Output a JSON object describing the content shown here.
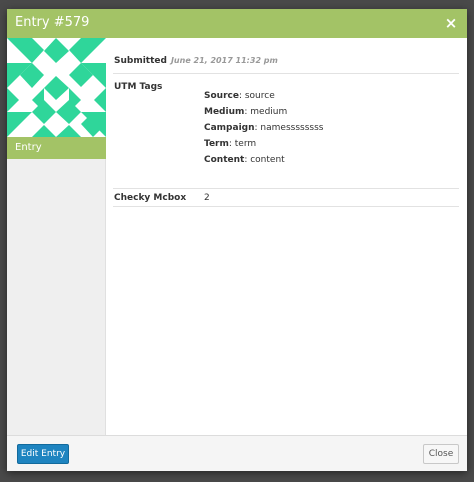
{
  "modal": {
    "title": "Entry #579",
    "close_glyph": "×",
    "close_icon": "close-icon"
  },
  "sidebar": {
    "avatar_colors": {
      "fill": "#2fd69a",
      "background": "#ffffff"
    },
    "tabs": [
      {
        "label": "Entry"
      }
    ]
  },
  "entry": {
    "submitted": {
      "label": "Submitted",
      "date": "June 21, 2017 11:32 pm"
    },
    "utm": {
      "label": "UTM Tags",
      "items": [
        {
          "key": "Source",
          "value": "source"
        },
        {
          "key": "Medium",
          "value": "medium"
        },
        {
          "key": "Campaign",
          "value": "namessssssss"
        },
        {
          "key": "Term",
          "value": "term"
        },
        {
          "key": "Content",
          "value": "content"
        }
      ]
    },
    "checky": {
      "label": "Checky Mcbox",
      "value": "2"
    }
  },
  "footer": {
    "edit_label": "Edit Entry",
    "close_label": "Close"
  },
  "colors": {
    "header": "#a3c366",
    "primary_button": "#1e84c0",
    "backdrop": "#4a4a4a"
  }
}
